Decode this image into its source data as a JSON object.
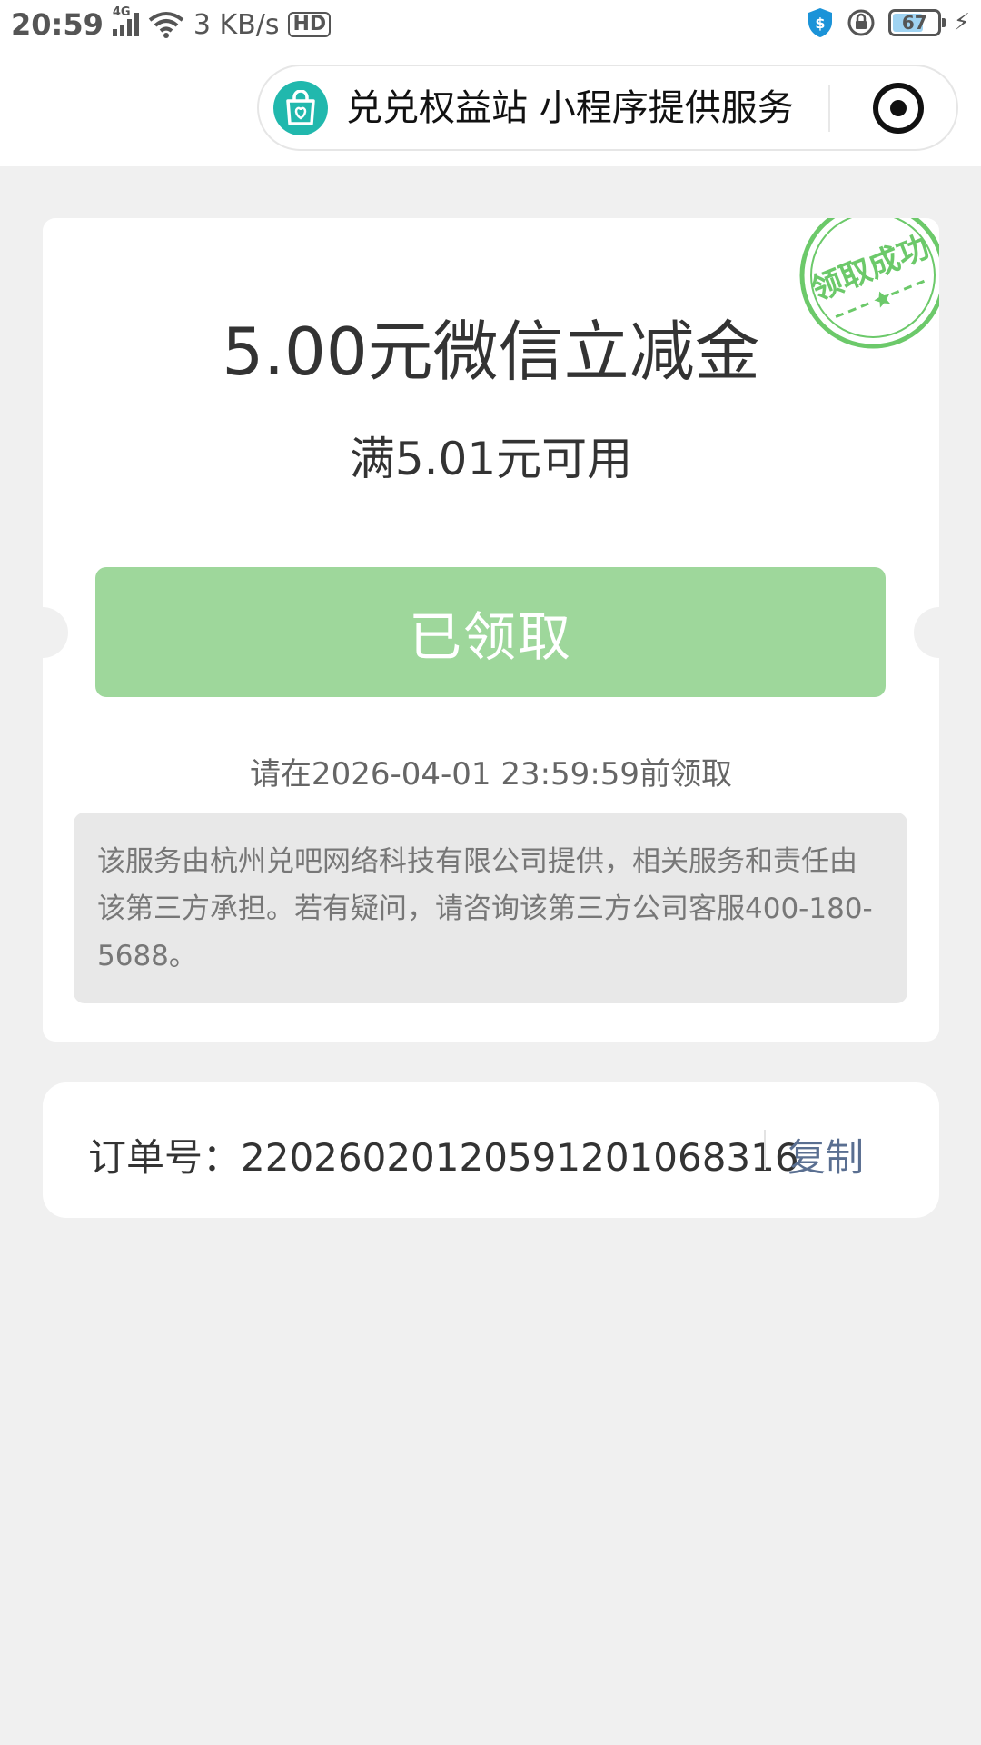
{
  "status_bar": {
    "time": "20:59",
    "network": "4G",
    "speed": "3 KB/s",
    "hd": "HD",
    "battery": "67"
  },
  "mini_program": {
    "name_line": "兑兑权益站 小程序提供服务"
  },
  "coupon": {
    "title": "5.00元微信立减金",
    "condition": "满5.01元可用",
    "button_label": "已领取",
    "deadline": "请在2026-04-01 23:59:59前领取",
    "notice": "该服务由杭州兑吧网络科技有限公司提供，相关服务和责任由该第三方承担。若有疑问，请咨询该第三方公司客服400-180-5688。",
    "stamp_text": "领取成功"
  },
  "order": {
    "label": "订单号：2202602012059120106831​6",
    "copy_label": "复制"
  },
  "colors": {
    "button_green": "#9ed79b",
    "stamp_green": "#6cc96a",
    "link_blue": "#5a6f91",
    "page_bg": "#f0f0f0"
  }
}
